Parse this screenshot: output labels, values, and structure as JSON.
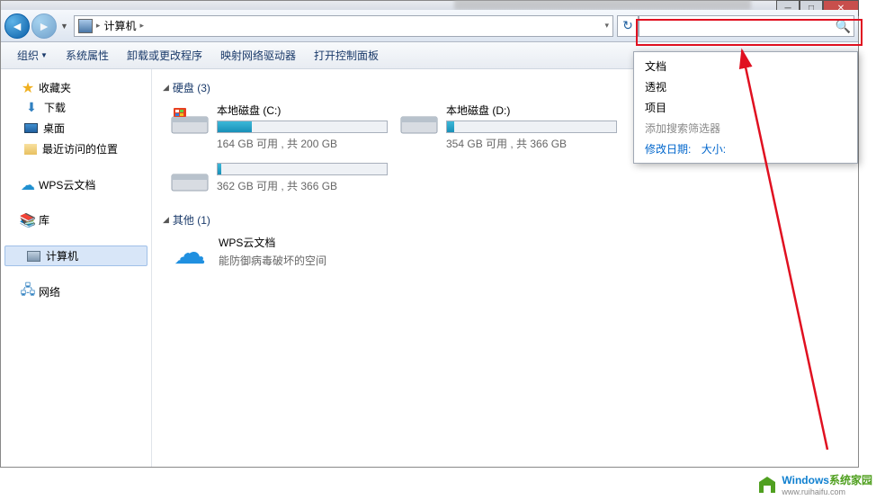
{
  "breadcrumb": {
    "location": "计算机"
  },
  "search": {
    "placeholder": ""
  },
  "search_dropdown": {
    "items": [
      "文档",
      "透视",
      "项目"
    ],
    "filter_label": "添加搜索筛选器",
    "filters": [
      "修改日期:",
      "大小:"
    ]
  },
  "toolbar": {
    "organize": "组织",
    "properties": "系统属性",
    "uninstall": "卸载或更改程序",
    "map_drive": "映射网络驱动器",
    "control_panel": "打开控制面板"
  },
  "nav_pane": {
    "favorites": {
      "label": "收藏夹",
      "items": [
        {
          "label": "下载"
        },
        {
          "label": "桌面"
        },
        {
          "label": "最近访问的位置"
        }
      ]
    },
    "wps": {
      "label": "WPS云文档"
    },
    "libraries": {
      "label": "库"
    },
    "computer": {
      "label": "计算机"
    },
    "network": {
      "label": "网络"
    }
  },
  "groups": {
    "drives": {
      "header": "硬盘 (3)",
      "items": [
        {
          "name": "本地磁盘 (C:)",
          "fill_pct": 20,
          "stats": "164 GB 可用 , 共 200 GB"
        },
        {
          "name": "本地磁盘 (D:)",
          "fill_pct": 4,
          "stats": "354 GB 可用 , 共 366 GB"
        },
        {
          "name": "",
          "fill_pct": 2,
          "stats": "362 GB 可用 , 共 366 GB"
        }
      ]
    },
    "other": {
      "header": "其他 (1)",
      "items": [
        {
          "name": "WPS云文档",
          "desc": "能防御病毒破坏的空间"
        }
      ]
    }
  },
  "watermark": {
    "brand_a": "Windows",
    "brand_b": "系统家园",
    "sub": "www.ruihaifu.com"
  }
}
